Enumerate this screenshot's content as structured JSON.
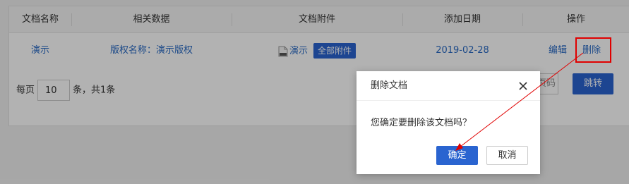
{
  "table": {
    "headers": [
      "文档名称",
      "相关数据",
      "文档附件",
      "添加日期",
      "操作"
    ],
    "row": {
      "name": "演示",
      "related": "版权名称：演示版权",
      "attachment_name": "演示",
      "attachment_button": "全部附件",
      "date": "2019-02-28",
      "edit": "编辑",
      "delete": "删除"
    }
  },
  "pager": {
    "per_page_label": "每页",
    "page_size": "10",
    "summary": "条，共1条",
    "page_input_placeholder": "入页码",
    "jump": "跳转"
  },
  "dialog": {
    "title": "删除文档",
    "message": "您确定要删除该文档吗？",
    "confirm": "确定",
    "cancel": "取消"
  },
  "colors": {
    "primary": "#2a64d0",
    "link": "#2a6bc4",
    "annotation": "#e00000"
  }
}
